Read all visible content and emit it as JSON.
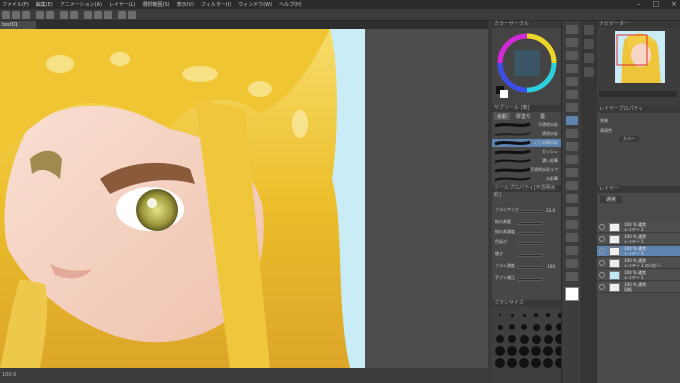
{
  "window": {
    "menu": [
      "ファイル(F)",
      "編集(E)",
      "アニメーション(A)",
      "レイヤー(L)",
      "選択範囲(S)",
      "表示(V)",
      "フィルター(I)",
      "ウィンドウ(W)",
      "ヘルプ(H)"
    ],
    "title": "test01 (1174 x 1600px 720dpi 100.0%) - 体験版：あと 30 日間すべての機能を使用可能です - このライセンス残 30 日後です - CLIP STUDIO PAINT PRO"
  },
  "canvas_tab": {
    "label": "test01"
  },
  "status": {
    "zoom": "100.0"
  },
  "color_panel": {
    "tabs": [
      "カラーサークル",
      "カラーセット"
    ]
  },
  "brush_panel": {
    "title": "サブツール [筆]",
    "categories": [
      "水彩",
      "厚塗り",
      "墨"
    ],
    "brushes": [
      "不透明水彩",
      "透明水彩",
      "にじみ縁水彩",
      "ガッシュ",
      "濃い鉛筆",
      "不透明水彩ラフ",
      "水彩筆"
    ]
  },
  "tool_property": {
    "title": "ツールプロパティ[不透明水彩]",
    "props": [
      {
        "label": "ブラシサイズ",
        "value": "23.0"
      },
      {
        "label": "絵の具量",
        "value": ""
      },
      {
        "label": "絵の具濃度",
        "value": ""
      },
      {
        "label": "色延び",
        "value": ""
      },
      {
        "label": "硬さ",
        "value": ""
      },
      {
        "label": "ブラシ濃度",
        "value": "100"
      },
      {
        "label": "手ブレ補正",
        "value": ""
      }
    ]
  },
  "brush_size_panel": {
    "title": "ブラシサイズ"
  },
  "navigator": {
    "tabs": [
      "ナビゲーター",
      "サブビュー"
    ]
  },
  "layer_property": {
    "title": "レイヤープロパティ",
    "labels": [
      "効果",
      "表現色"
    ],
    "expression_color": "カラー"
  },
  "layers": {
    "tabs": [
      "レイヤー",
      "レイヤー検索"
    ],
    "blend_mode": "通常",
    "items": [
      {
        "name1": "100 % 通常",
        "name2": "レイヤー 2",
        "selected": false
      },
      {
        "name1": "100 % 通常",
        "name2": "レイヤー 5",
        "selected": false
      },
      {
        "name1": "100 % 通常",
        "name2": "レイヤー 4",
        "selected": true
      },
      {
        "name1": "100 % 通常",
        "name2": "レイヤー 1 のコピー",
        "selected": false
      },
      {
        "name1": "100 % 通常",
        "name2": "レイヤー 1",
        "selected": false
      },
      {
        "name1": "100 % 通常",
        "name2": "用紙",
        "selected": false
      }
    ]
  },
  "colors": {
    "accent": "#5d83b0",
    "sky": "#c9ecf6",
    "hair": "#f2c52e"
  },
  "icons": [
    "minimize-icon",
    "maximize-icon",
    "close-icon",
    "eye-icon",
    "color-wheel-icon"
  ]
}
